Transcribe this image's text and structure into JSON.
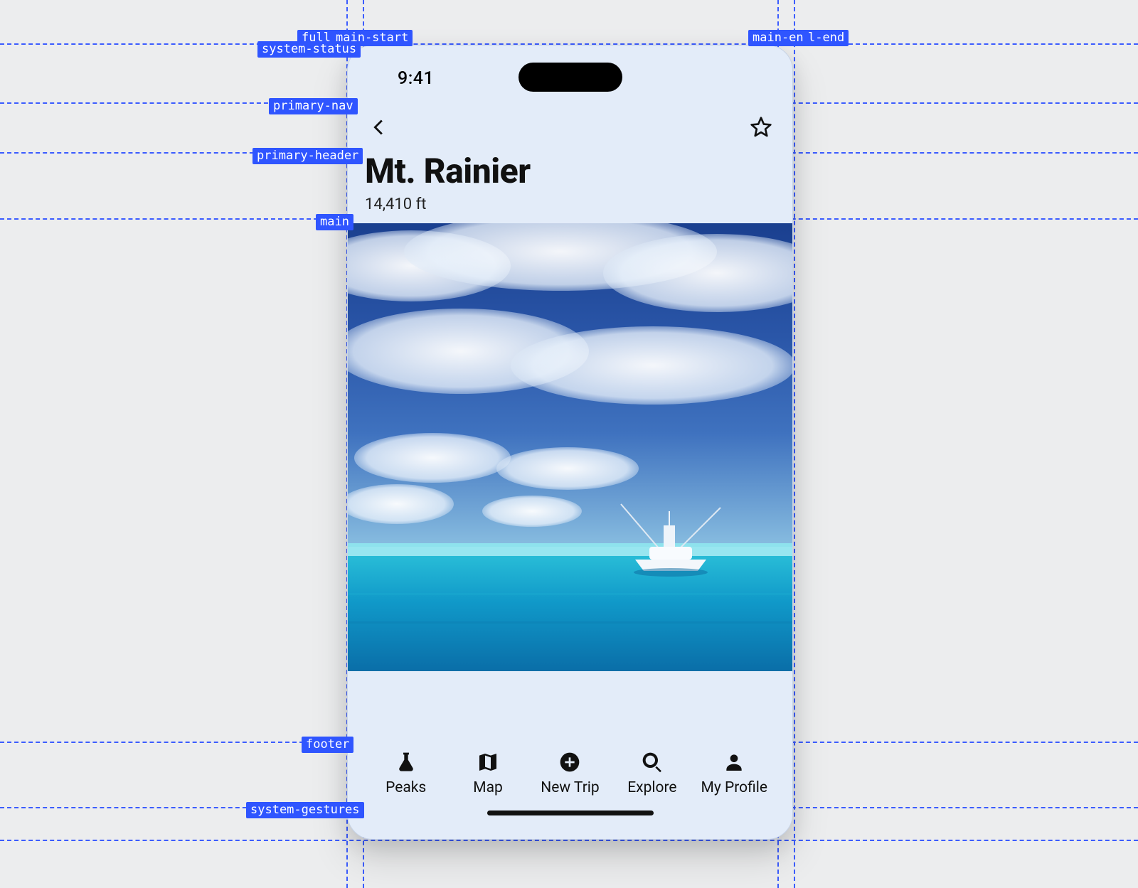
{
  "status": {
    "time": "9:41"
  },
  "nav": {
    "back_icon": "chevron-left",
    "star_icon": "star-outline"
  },
  "header": {
    "title": "Mt. Rainier",
    "subtitle": "14,410 ft"
  },
  "tabs": [
    {
      "icon": "science",
      "label": "Peaks"
    },
    {
      "icon": "map",
      "label": "Map"
    },
    {
      "icon": "add-circle",
      "label": "New Trip"
    },
    {
      "icon": "search",
      "label": "Explore"
    },
    {
      "icon": "person",
      "label": "My Profile"
    }
  ],
  "guides": {
    "vlabels": {
      "full_left": "full-",
      "main_start": "main-start",
      "main_end": "main-end",
      "full_end": "l-end"
    },
    "hlabels": {
      "system_status": "system-status",
      "primary_nav": "primary-nav",
      "primary_header": "primary-header",
      "main": "main",
      "footer": "footer",
      "system_gestures": "system-gestures"
    }
  }
}
